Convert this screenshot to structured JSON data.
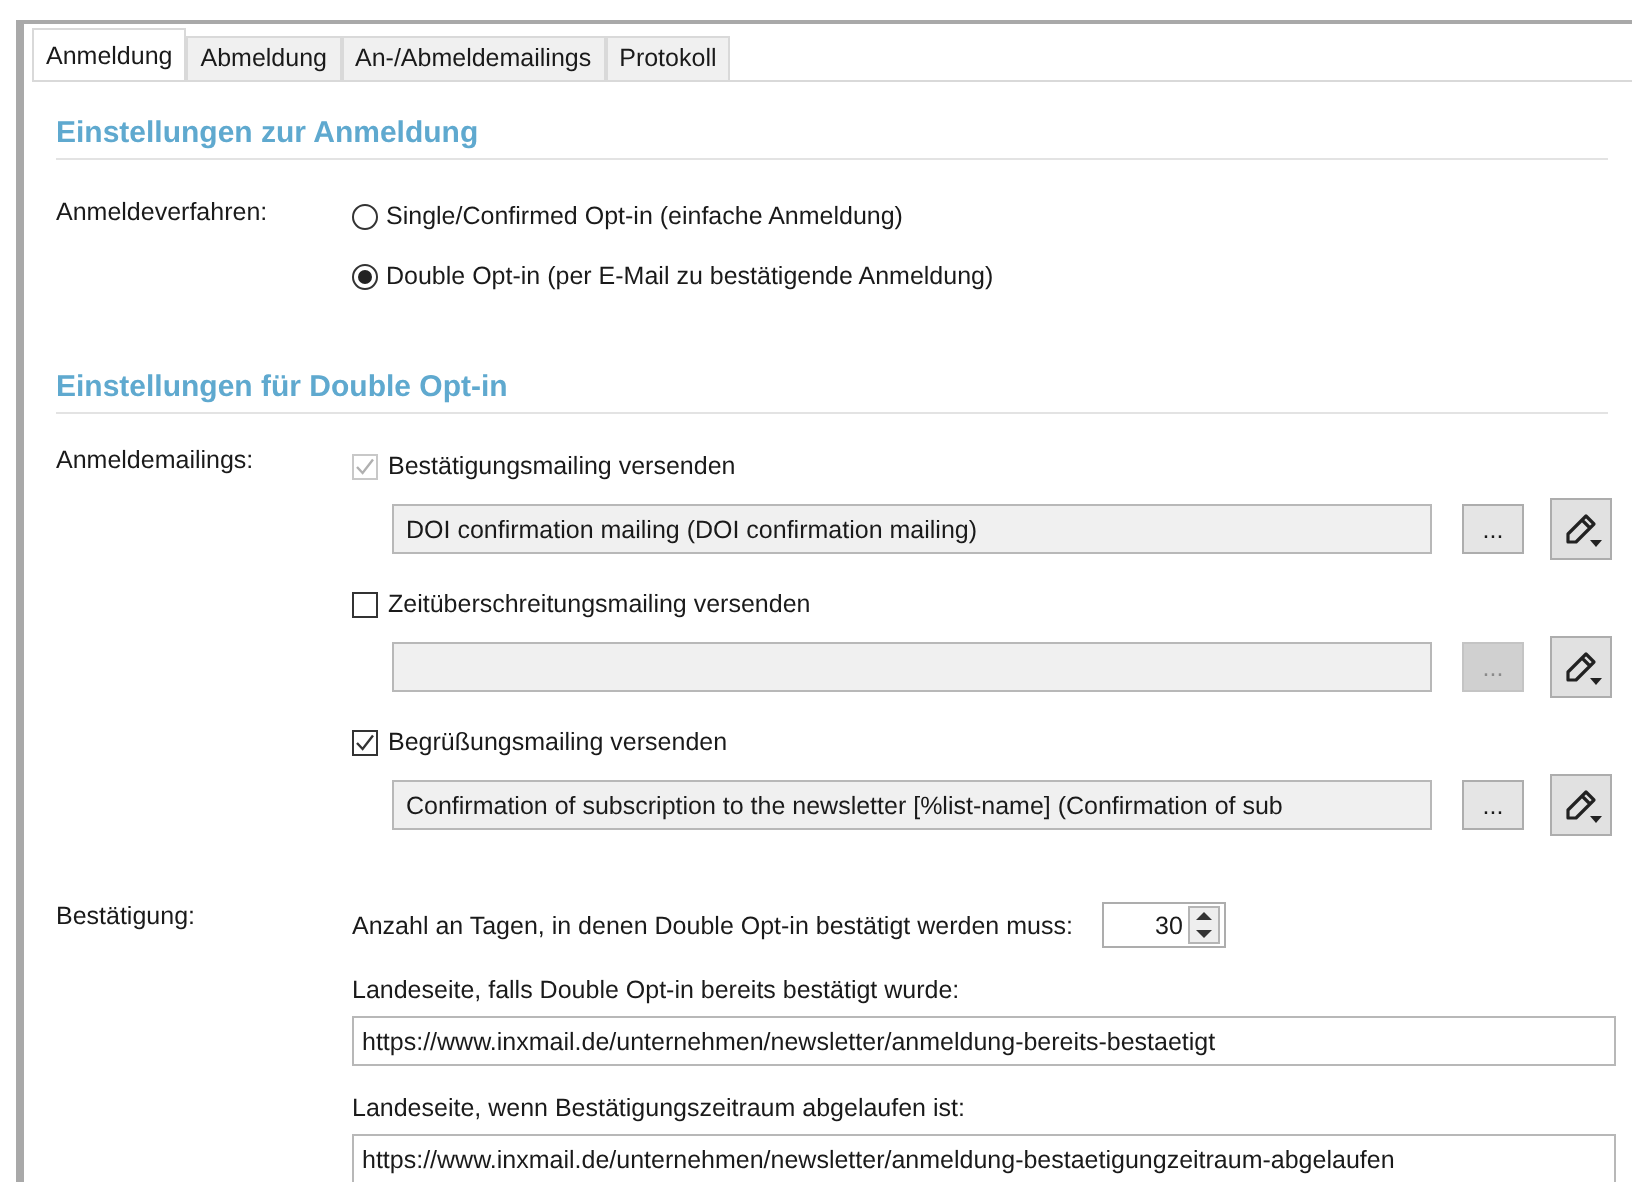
{
  "tabs": [
    {
      "label": "Anmeldung",
      "selected": true
    },
    {
      "label": "Abmeldung",
      "selected": false
    },
    {
      "label": "An-/Abmeldemailings",
      "selected": false
    },
    {
      "label": "Protokoll",
      "selected": false
    }
  ],
  "registration": {
    "heading": "Einstellungen zur Anmeldung",
    "method_label": "Anmeldeverfahren:",
    "options": [
      {
        "label": "Single/Confirmed Opt-in (einfache Anmeldung)",
        "selected": false
      },
      {
        "label": "Double Opt-in (per E-Mail zu bestätigende Anmeldung)",
        "selected": true
      }
    ]
  },
  "double_opt_in": {
    "heading": "Einstellungen für Double Opt-in",
    "mailings_label": "Anmeldemailings:",
    "mailings": [
      {
        "label": "Bestätigungsmailing versenden",
        "checked": true,
        "disabled": true,
        "value": "DOI confirmation mailing (DOI confirmation mailing)",
        "browse": "...",
        "browse_disabled": false
      },
      {
        "label": "Zeitüberschreitungsmailing versenden",
        "checked": false,
        "disabled": false,
        "browse": "...",
        "browse_disabled": true
      },
      {
        "label": "Begrüßungsmailing versenden",
        "checked": true,
        "disabled": false,
        "value": "Confirmation of subscription to the newsletter [%list-name] (Confirmation of sub",
        "browse": "...",
        "browse_disabled": false
      }
    ],
    "confirmation_label": "Bestätigung:",
    "days_label": "Anzahl an Tagen, in denen Double Opt-in bestätigt werden muss:",
    "days": "30",
    "already_label": "Landeseite, falls Double Opt-in bereits bestätigt wurde:",
    "already_url": "https://www.inxmail.de/unternehmen/newsletter/anmeldung-bereits-bestaetigt",
    "expired_label": "Landeseite, wenn Bestätigungszeitraum abgelaufen ist:",
    "expired_url": "https://www.inxmail.de/unternehmen/newsletter/anmeldung-bestaetigungzeitraum-abgelaufen"
  }
}
